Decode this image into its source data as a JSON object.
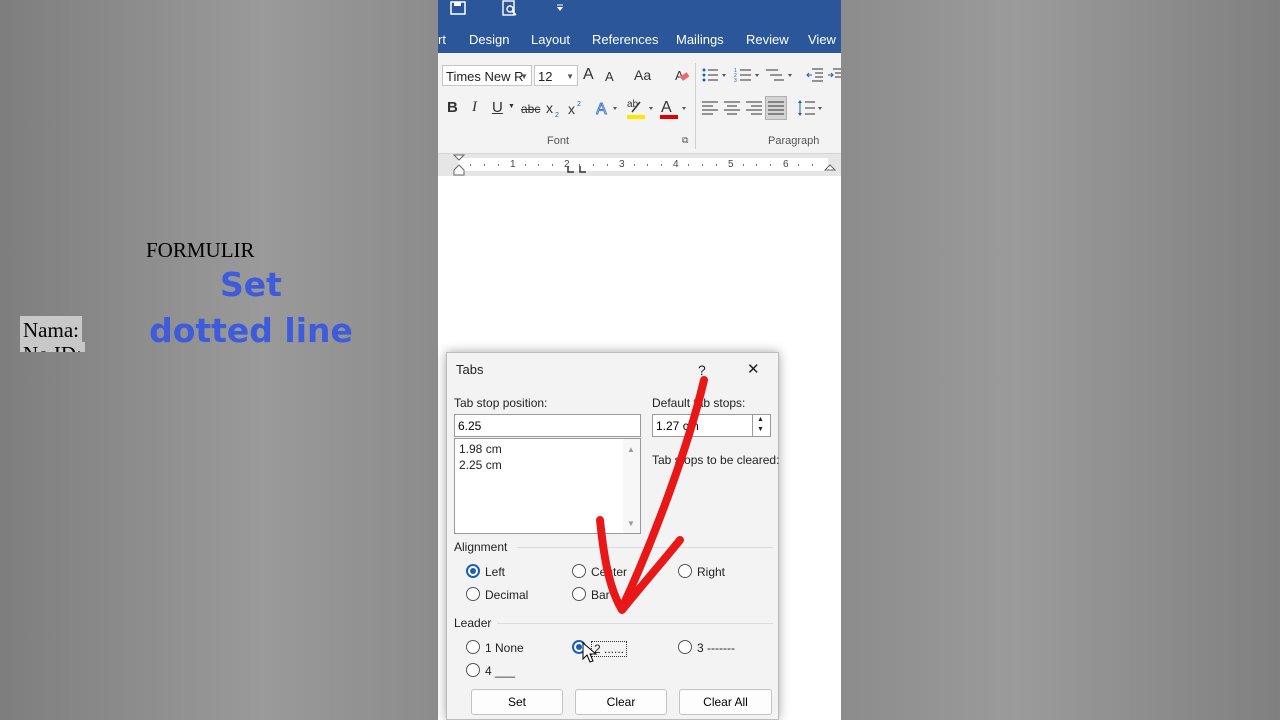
{
  "ribbon_tabs": [
    "rt",
    "Design",
    "Layout",
    "References",
    "Mailings",
    "Review",
    "View"
  ],
  "font": {
    "name": "Times New R",
    "size": "12",
    "group_label": "Font",
    "bold": "B",
    "italic": "I",
    "underline": "U",
    "strike": "abc",
    "grow": "A",
    "shrink": "A",
    "case": "Aa"
  },
  "paragraph": {
    "group_label": "Paragraph"
  },
  "ruler_numbers": [
    "1",
    "2",
    "3",
    "4",
    "5",
    "6"
  ],
  "document": {
    "title": "FORMULIR",
    "field1": "Nama:",
    "field2": "No ID:"
  },
  "overlay_text": {
    "line1": "Set",
    "line2": "dotted line"
  },
  "dialog": {
    "title": "Tabs",
    "help": "?",
    "close": "✕",
    "tab_stop_label": "Tab stop position:",
    "tab_stop_value": "6.25",
    "tab_stops": [
      "1.98 cm",
      "2.25 cm"
    ],
    "default_label": "Default tab stops:",
    "default_value": "1.27 cm",
    "cleared_label": "Tab stops to be cleared:",
    "alignment_label": "Alignment",
    "alignment": {
      "left": "Left",
      "center": "Center",
      "right": "Right",
      "decimal": "Decimal",
      "bar": "Bar"
    },
    "leader_label": "Leader",
    "leader": {
      "none": "1 None",
      "dots": "2 ......",
      "dashes": "3 -------",
      "line": "4 ___"
    },
    "buttons": {
      "set": "Set",
      "clear": "Clear",
      "clear_all": "Clear All"
    }
  },
  "colors": {
    "accent": "#2b579a",
    "overlay": "#3d5bdb",
    "arrow": "#e81818"
  }
}
